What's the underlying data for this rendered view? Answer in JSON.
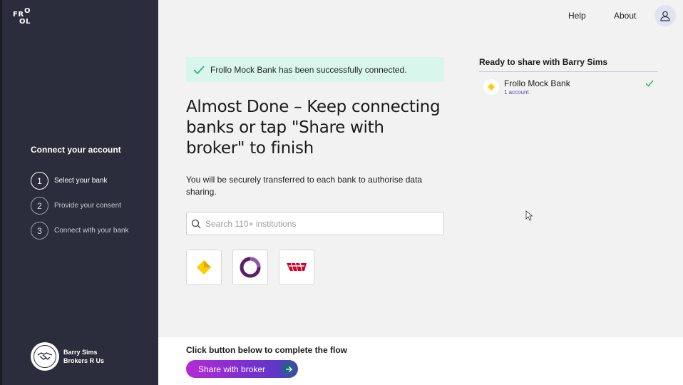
{
  "brand": {
    "logo_text": "FROLLO"
  },
  "nav": {
    "help": "Help",
    "about": "About"
  },
  "sidebar": {
    "title": "Connect your account",
    "steps": [
      {
        "num": "1",
        "label": "Select your bank"
      },
      {
        "num": "2",
        "label": "Provide your consent"
      },
      {
        "num": "3",
        "label": "Connect with your bank"
      }
    ],
    "broker": {
      "name": "Barry Sims",
      "company": "Brokers R Us"
    }
  },
  "main": {
    "banner": "Frollo Mock Bank has been successfully connected.",
    "headline": "Almost Done – Keep connecting banks or tap \"Share with broker\" to finish",
    "subtext": "You will be securely transferred to each bank to authorise data sharing.",
    "search": {
      "placeholder": "Search 110+ institutions"
    },
    "banks": [
      "commonwealth-bank",
      "ing-bank",
      "westpac-bank"
    ]
  },
  "ready": {
    "title": "Ready to share with Barry Sims",
    "items": [
      {
        "name": "Frollo Mock Bank",
        "sub": "1 account"
      }
    ]
  },
  "bottom": {
    "text": "Click button below to complete the flow",
    "button": "Share with broker"
  },
  "colors": {
    "sidebar": "#2b2d3c",
    "banner": "#d9f6ec",
    "accent_green": "#2bb673",
    "button_start": "#b52bd6",
    "button_end": "#4a3fbe",
    "westpac_red": "#d5002b",
    "cba_yellow": "#ffcc00",
    "ing_purple": "#5a1f6b"
  }
}
